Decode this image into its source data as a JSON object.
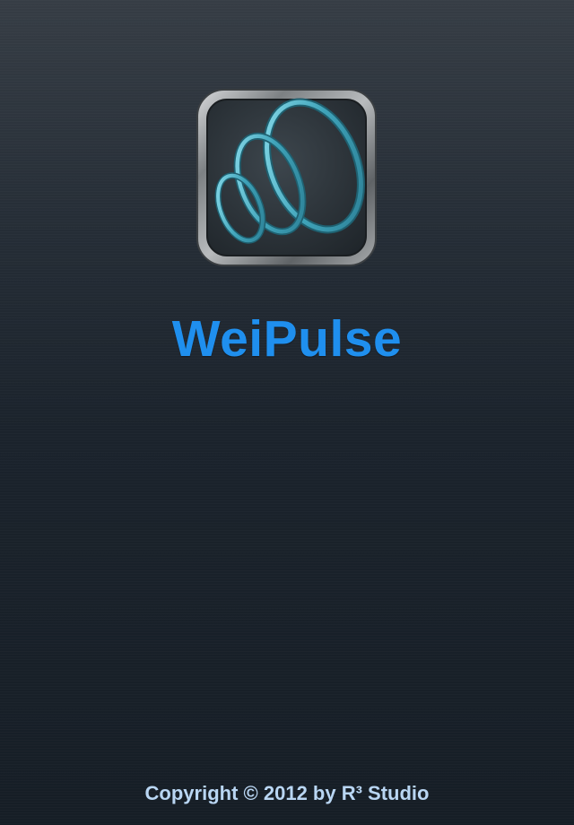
{
  "splash": {
    "app_name": "WeiPulse",
    "copyright": "Copyright © 2012 by R³ Studio",
    "icon": "pulse-rings-logo-icon"
  },
  "colors": {
    "background_top": "#363d45",
    "background_bottom": "#161e26",
    "title": "#1f8fee",
    "copyright": "#b9d6f3",
    "ring": "#4fb3c8"
  }
}
